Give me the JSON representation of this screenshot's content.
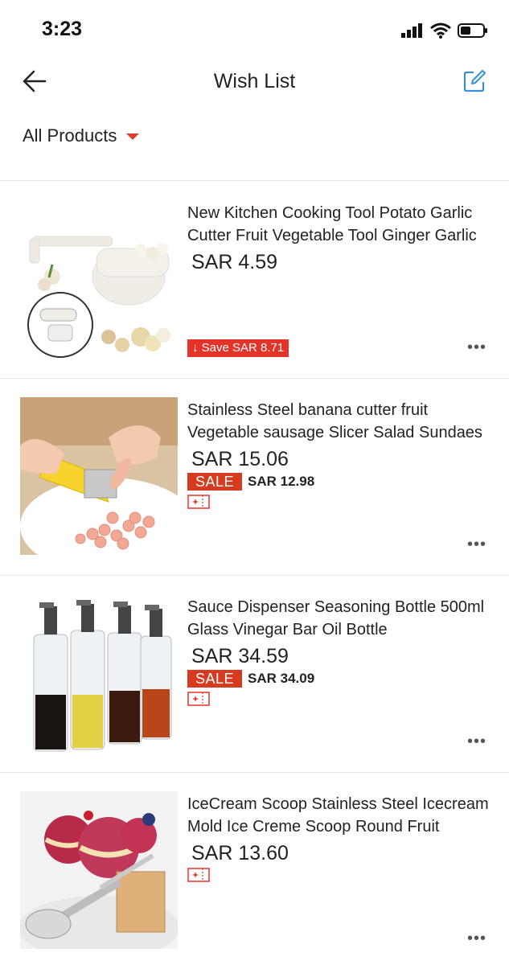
{
  "status_bar": {
    "time": "3:23"
  },
  "header": {
    "title": "Wish List"
  },
  "filter": {
    "label": "All Products"
  },
  "products": [
    {
      "title": "New Kitchen Cooking Tool Potato Garlic Cutter Fruit Vegetable Tool Ginger Garlic",
      "price": "SAR 4.59",
      "save": "↓ Save SAR 8.71"
    },
    {
      "title": "Stainless Steel banana cutter fruit Vegetable sausage Slicer Salad Sundaes",
      "price": "SAR 15.06",
      "sale_label": "SALE",
      "sale_price": "SAR 12.98"
    },
    {
      "title": "Sauce Dispenser Seasoning Bottle 500ml Glass Vinegar Bar Oil Bottle",
      "price": "SAR 34.59",
      "sale_label": "SALE",
      "sale_price": "SAR 34.09"
    },
    {
      "title": "IceCream Scoop Stainless Steel Icecream Mold Ice Creme Scoop Round Fruit",
      "price": "SAR 13.60"
    }
  ],
  "icons": {
    "back": "back-arrow-icon",
    "edit": "edit-icon",
    "more": "more-dots-icon",
    "coupon": "coupon-icon"
  },
  "colors": {
    "accent": "#e5332a",
    "sale": "#d63b1f",
    "edit_icon": "#3a8fd9"
  }
}
